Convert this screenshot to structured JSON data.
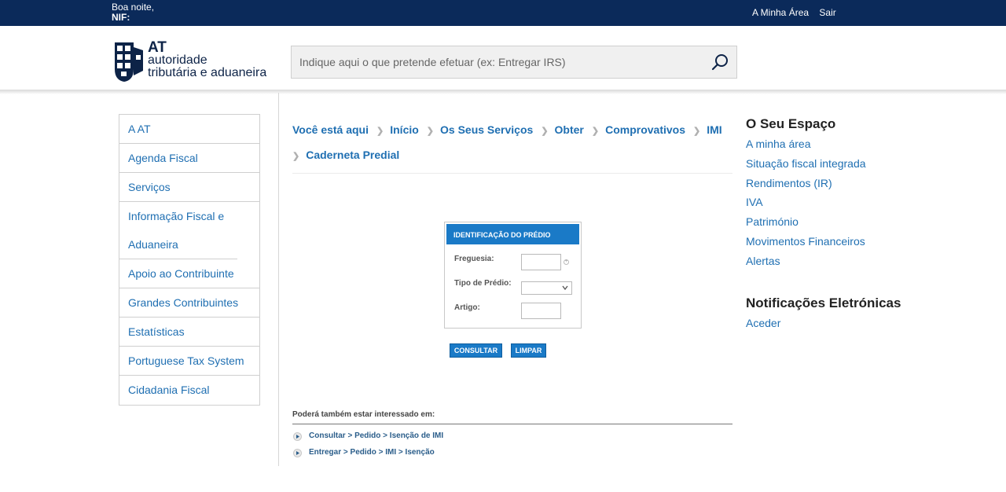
{
  "topbar": {
    "greeting": "Boa noite,",
    "nif_label": "NIF:",
    "links": [
      "A Minha Área",
      "Sair"
    ]
  },
  "header": {
    "logo": {
      "line1": "AT",
      "line2": "autoridade",
      "line3": "tributária e aduaneira"
    },
    "search": {
      "placeholder": "Indique aqui o que pretende efetuar (ex: Entregar IRS)"
    }
  },
  "sidebar": {
    "items": [
      {
        "label": "A AT"
      },
      {
        "label": "Agenda Fiscal"
      },
      {
        "label": "Serviços"
      },
      {
        "label": "Informação Fiscal e Aduaneira"
      },
      {
        "label": "Apoio ao Contribuinte"
      },
      {
        "label": "Grandes Contribuintes"
      },
      {
        "label": "Estatísticas"
      },
      {
        "label": "Portuguese Tax System"
      },
      {
        "label": "Cidadania Fiscal"
      }
    ]
  },
  "breadcrumb": {
    "items": [
      "Você está aqui",
      "Início",
      "Os Seus Serviços",
      "Obter",
      "Comprovativos",
      "IMI",
      "Caderneta Predial"
    ]
  },
  "form": {
    "title": "IDENTIFICAÇÃO DO PRÉDIO",
    "fields": {
      "freguesia": "Freguesia:",
      "tipo": "Tipo de Prédio:",
      "artigo": "Artigo:"
    },
    "freguesia_value": "",
    "artigo_value": "",
    "tipo_selected": ""
  },
  "buttons": {
    "consultar": "CONSULTAR",
    "limpar": "LIMPAR"
  },
  "interest": {
    "heading": "Poderá também estar interessado em:",
    "links": [
      "Consultar > Pedido > Isenção de IMI",
      "Entregar > Pedido > IMI > Isenção"
    ]
  },
  "right": {
    "espaco_title": "O Seu Espaço",
    "espaco_links": [
      "A minha área",
      "Situação fiscal integrada",
      "Rendimentos (IR)",
      "IVA",
      "Património",
      "Movimentos Financeiros",
      "Alertas"
    ],
    "notif_title": "Notificações Eletrónicas",
    "notif_link": "Aceder"
  },
  "colors": {
    "topbar": "#0b2a5a",
    "link": "#1f6fb2",
    "button": "#1a7ac7"
  }
}
